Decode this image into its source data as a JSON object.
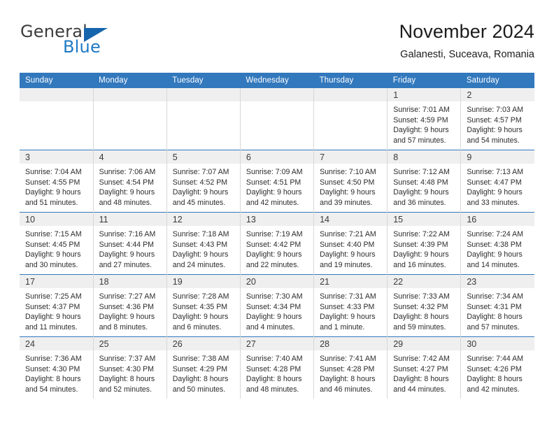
{
  "brand": {
    "name_top": "General",
    "name_bottom": "Blue",
    "triangle_icon": "triangle-icon",
    "color_top": "#3c3c3c",
    "color_bottom": "#1e7ac4"
  },
  "header": {
    "title": "November 2024",
    "subtitle": "Galanesti, Suceava, Romania"
  },
  "theme": {
    "header_blue": "#3278bd",
    "daynum_band": "#efefef",
    "grid_line": "#d7d7d7"
  },
  "weekday_headers": [
    "Sunday",
    "Monday",
    "Tuesday",
    "Wednesday",
    "Thursday",
    "Friday",
    "Saturday"
  ],
  "weeks": [
    [
      {
        "day": "",
        "empty": true
      },
      {
        "day": "",
        "empty": true
      },
      {
        "day": "",
        "empty": true
      },
      {
        "day": "",
        "empty": true
      },
      {
        "day": "",
        "empty": true
      },
      {
        "day": "1",
        "empty": false,
        "sunrise": "Sunrise: 7:01 AM",
        "sunset": "Sunset: 4:59 PM",
        "daylight1": "Daylight: 9 hours",
        "daylight2": "and 57 minutes."
      },
      {
        "day": "2",
        "empty": false,
        "sunrise": "Sunrise: 7:03 AM",
        "sunset": "Sunset: 4:57 PM",
        "daylight1": "Daylight: 9 hours",
        "daylight2": "and 54 minutes."
      }
    ],
    [
      {
        "day": "3",
        "empty": false,
        "sunrise": "Sunrise: 7:04 AM",
        "sunset": "Sunset: 4:55 PM",
        "daylight1": "Daylight: 9 hours",
        "daylight2": "and 51 minutes."
      },
      {
        "day": "4",
        "empty": false,
        "sunrise": "Sunrise: 7:06 AM",
        "sunset": "Sunset: 4:54 PM",
        "daylight1": "Daylight: 9 hours",
        "daylight2": "and 48 minutes."
      },
      {
        "day": "5",
        "empty": false,
        "sunrise": "Sunrise: 7:07 AM",
        "sunset": "Sunset: 4:52 PM",
        "daylight1": "Daylight: 9 hours",
        "daylight2": "and 45 minutes."
      },
      {
        "day": "6",
        "empty": false,
        "sunrise": "Sunrise: 7:09 AM",
        "sunset": "Sunset: 4:51 PM",
        "daylight1": "Daylight: 9 hours",
        "daylight2": "and 42 minutes."
      },
      {
        "day": "7",
        "empty": false,
        "sunrise": "Sunrise: 7:10 AM",
        "sunset": "Sunset: 4:50 PM",
        "daylight1": "Daylight: 9 hours",
        "daylight2": "and 39 minutes."
      },
      {
        "day": "8",
        "empty": false,
        "sunrise": "Sunrise: 7:12 AM",
        "sunset": "Sunset: 4:48 PM",
        "daylight1": "Daylight: 9 hours",
        "daylight2": "and 36 minutes."
      },
      {
        "day": "9",
        "empty": false,
        "sunrise": "Sunrise: 7:13 AM",
        "sunset": "Sunset: 4:47 PM",
        "daylight1": "Daylight: 9 hours",
        "daylight2": "and 33 minutes."
      }
    ],
    [
      {
        "day": "10",
        "empty": false,
        "sunrise": "Sunrise: 7:15 AM",
        "sunset": "Sunset: 4:45 PM",
        "daylight1": "Daylight: 9 hours",
        "daylight2": "and 30 minutes."
      },
      {
        "day": "11",
        "empty": false,
        "sunrise": "Sunrise: 7:16 AM",
        "sunset": "Sunset: 4:44 PM",
        "daylight1": "Daylight: 9 hours",
        "daylight2": "and 27 minutes."
      },
      {
        "day": "12",
        "empty": false,
        "sunrise": "Sunrise: 7:18 AM",
        "sunset": "Sunset: 4:43 PM",
        "daylight1": "Daylight: 9 hours",
        "daylight2": "and 24 minutes."
      },
      {
        "day": "13",
        "empty": false,
        "sunrise": "Sunrise: 7:19 AM",
        "sunset": "Sunset: 4:42 PM",
        "daylight1": "Daylight: 9 hours",
        "daylight2": "and 22 minutes."
      },
      {
        "day": "14",
        "empty": false,
        "sunrise": "Sunrise: 7:21 AM",
        "sunset": "Sunset: 4:40 PM",
        "daylight1": "Daylight: 9 hours",
        "daylight2": "and 19 minutes."
      },
      {
        "day": "15",
        "empty": false,
        "sunrise": "Sunrise: 7:22 AM",
        "sunset": "Sunset: 4:39 PM",
        "daylight1": "Daylight: 9 hours",
        "daylight2": "and 16 minutes."
      },
      {
        "day": "16",
        "empty": false,
        "sunrise": "Sunrise: 7:24 AM",
        "sunset": "Sunset: 4:38 PM",
        "daylight1": "Daylight: 9 hours",
        "daylight2": "and 14 minutes."
      }
    ],
    [
      {
        "day": "17",
        "empty": false,
        "sunrise": "Sunrise: 7:25 AM",
        "sunset": "Sunset: 4:37 PM",
        "daylight1": "Daylight: 9 hours",
        "daylight2": "and 11 minutes."
      },
      {
        "day": "18",
        "empty": false,
        "sunrise": "Sunrise: 7:27 AM",
        "sunset": "Sunset: 4:36 PM",
        "daylight1": "Daylight: 9 hours",
        "daylight2": "and 8 minutes."
      },
      {
        "day": "19",
        "empty": false,
        "sunrise": "Sunrise: 7:28 AM",
        "sunset": "Sunset: 4:35 PM",
        "daylight1": "Daylight: 9 hours",
        "daylight2": "and 6 minutes."
      },
      {
        "day": "20",
        "empty": false,
        "sunrise": "Sunrise: 7:30 AM",
        "sunset": "Sunset: 4:34 PM",
        "daylight1": "Daylight: 9 hours",
        "daylight2": "and 4 minutes."
      },
      {
        "day": "21",
        "empty": false,
        "sunrise": "Sunrise: 7:31 AM",
        "sunset": "Sunset: 4:33 PM",
        "daylight1": "Daylight: 9 hours",
        "daylight2": "and 1 minute."
      },
      {
        "day": "22",
        "empty": false,
        "sunrise": "Sunrise: 7:33 AM",
        "sunset": "Sunset: 4:32 PM",
        "daylight1": "Daylight: 8 hours",
        "daylight2": "and 59 minutes."
      },
      {
        "day": "23",
        "empty": false,
        "sunrise": "Sunrise: 7:34 AM",
        "sunset": "Sunset: 4:31 PM",
        "daylight1": "Daylight: 8 hours",
        "daylight2": "and 57 minutes."
      }
    ],
    [
      {
        "day": "24",
        "empty": false,
        "sunrise": "Sunrise: 7:36 AM",
        "sunset": "Sunset: 4:30 PM",
        "daylight1": "Daylight: 8 hours",
        "daylight2": "and 54 minutes."
      },
      {
        "day": "25",
        "empty": false,
        "sunrise": "Sunrise: 7:37 AM",
        "sunset": "Sunset: 4:30 PM",
        "daylight1": "Daylight: 8 hours",
        "daylight2": "and 52 minutes."
      },
      {
        "day": "26",
        "empty": false,
        "sunrise": "Sunrise: 7:38 AM",
        "sunset": "Sunset: 4:29 PM",
        "daylight1": "Daylight: 8 hours",
        "daylight2": "and 50 minutes."
      },
      {
        "day": "27",
        "empty": false,
        "sunrise": "Sunrise: 7:40 AM",
        "sunset": "Sunset: 4:28 PM",
        "daylight1": "Daylight: 8 hours",
        "daylight2": "and 48 minutes."
      },
      {
        "day": "28",
        "empty": false,
        "sunrise": "Sunrise: 7:41 AM",
        "sunset": "Sunset: 4:28 PM",
        "daylight1": "Daylight: 8 hours",
        "daylight2": "and 46 minutes."
      },
      {
        "day": "29",
        "empty": false,
        "sunrise": "Sunrise: 7:42 AM",
        "sunset": "Sunset: 4:27 PM",
        "daylight1": "Daylight: 8 hours",
        "daylight2": "and 44 minutes."
      },
      {
        "day": "30",
        "empty": false,
        "sunrise": "Sunrise: 7:44 AM",
        "sunset": "Sunset: 4:26 PM",
        "daylight1": "Daylight: 8 hours",
        "daylight2": "and 42 minutes."
      }
    ]
  ]
}
